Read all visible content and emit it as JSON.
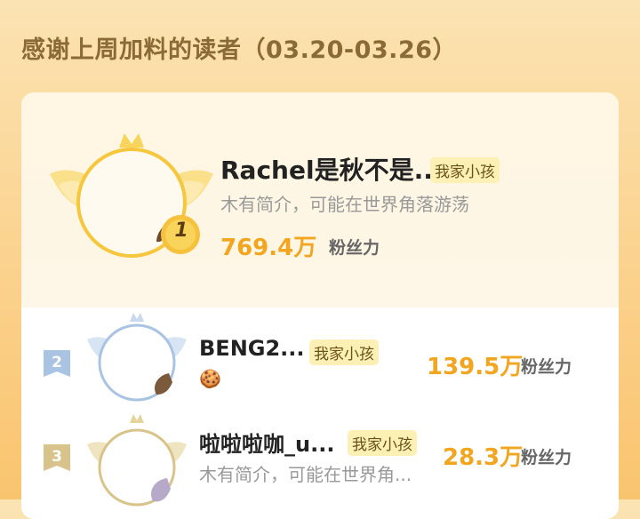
{
  "header": {
    "title": "感谢上周加料的读者（03.20-03.26）"
  },
  "readers": [
    {
      "rank": "1",
      "name": "Rachel是秋不是...",
      "tag": "我家小孩",
      "bio": "木有简介，可能在世界角落游荡",
      "fans_value": "769.4万",
      "fans_label": "粉丝力"
    },
    {
      "rank": "2",
      "name": "BENG2...",
      "tag": "我家小孩",
      "bio_emoji": "🍪",
      "fans_value": "139.5万",
      "fans_label": "粉丝力"
    },
    {
      "rank": "3",
      "name": "啦啦啦咖_u...",
      "tag": "我家小孩",
      "bio": "木有简介，可能在世界角...",
      "fans_value": "28.3万",
      "fans_label": "粉丝力"
    }
  ],
  "colors": {
    "gold": "#f2a51f",
    "gold_frame": "#f6c63c",
    "silver_frame": "#a9c3e3",
    "bronze_frame": "#d8c48a",
    "tag_bg": "#fdf0b4"
  },
  "icons": [
    "crown-icon",
    "wing-icon",
    "rank-medal-icon",
    "cookie-emoji"
  ]
}
